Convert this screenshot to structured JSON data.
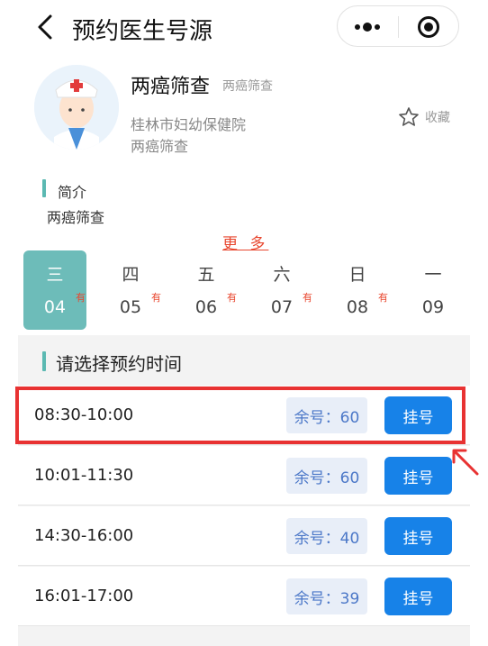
{
  "header": {
    "title": "预约医生号源",
    "back_icon": "chevron-left-icon",
    "more_icon": "more-dots-icon",
    "close_icon": "record-circle-icon"
  },
  "doctor": {
    "name": "两癌筛查",
    "title": "两癌筛查",
    "hospital": "桂林市妇幼保健院",
    "department": "两癌筛查",
    "favorite_label": "收藏",
    "avatar_icon": "doctor-avatar-icon"
  },
  "intro": {
    "heading": "简介",
    "text": "两癌筛查"
  },
  "more_label": "更 多",
  "days": [
    {
      "weekday": "三",
      "date": "04",
      "tag": "有",
      "active": true
    },
    {
      "weekday": "四",
      "date": "05",
      "tag": "有",
      "active": false
    },
    {
      "weekday": "五",
      "date": "06",
      "tag": "有",
      "active": false
    },
    {
      "weekday": "六",
      "date": "07",
      "tag": "有",
      "active": false
    },
    {
      "weekday": "日",
      "date": "08",
      "tag": "有",
      "active": false
    },
    {
      "weekday": "一",
      "date": "09",
      "tag": "",
      "active": false
    }
  ],
  "section_heading": "请选择预约时间",
  "slots": [
    {
      "time": "08:30-10:00",
      "remaining": "余号：60",
      "button": "挂号"
    },
    {
      "time": "10:01-11:30",
      "remaining": "余号：60",
      "button": "挂号"
    },
    {
      "time": "14:30-16:00",
      "remaining": "余号：40",
      "button": "挂号"
    },
    {
      "time": "16:01-17:00",
      "remaining": "余号：39",
      "button": "挂号"
    }
  ],
  "colors": {
    "accent_teal": "#6dbcb9",
    "primary_blue": "#1782e8",
    "tag_red": "#e8472f",
    "highlight_red": "#e83232"
  }
}
